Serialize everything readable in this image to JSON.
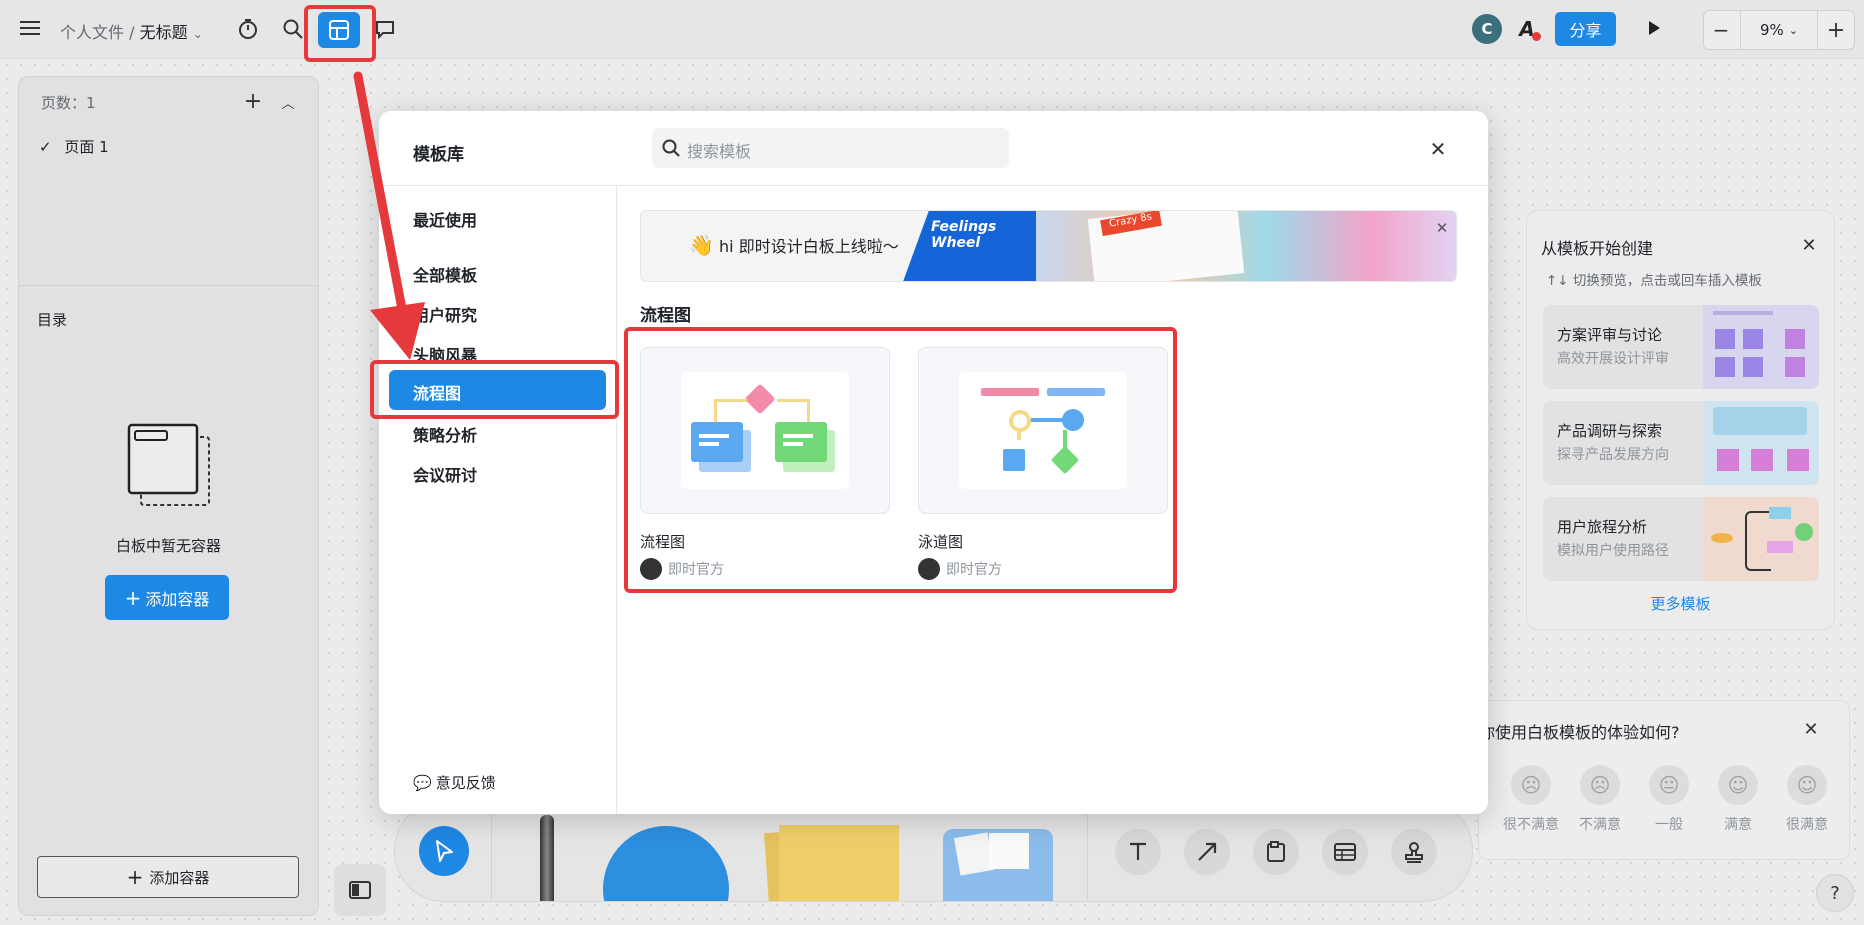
{
  "topbar": {
    "breadcrumb_root": "个人文件",
    "breadcrumb_sep": "/",
    "breadcrumb_title": "无标题",
    "avatar_letter": "C",
    "share_label": "分享",
    "zoom_value": "9%",
    "zoom_minus": "−",
    "zoom_plus": "+"
  },
  "sidebar": {
    "pages_label": "页数：1",
    "page_item": "页面 1",
    "toc_label": "目录",
    "empty_text": "白板中暂无容器",
    "add_container_primary": "添加容器",
    "add_container_bottom": "添加容器"
  },
  "modal": {
    "title": "模板库",
    "search_placeholder": "搜索模板",
    "nav": [
      "最近使用",
      "全部模板",
      "用户研究",
      "头脑风暴",
      "流程图",
      "策略分析",
      "会议研讨"
    ],
    "active_nav": "流程图",
    "feedback": "意见反馈",
    "banner_text_1": "hi",
    "banner_text_2": "即时设计白板上线啦～",
    "banner_fw": "Feelings Wheel",
    "banner_crazy": "Crazy 8s",
    "section_title": "流程图",
    "cards": [
      {
        "name": "流程图",
        "author": "即时官方"
      },
      {
        "name": "泳道图",
        "author": "即时官方"
      }
    ]
  },
  "right_panel": {
    "title": "从模板开始创建",
    "hint": "↑↓ 切换预览，点击或回车插入模板",
    "items": [
      {
        "title": "方案评审与讨论",
        "desc": "高效开展设计评审"
      },
      {
        "title": "产品调研与探索",
        "desc": "探寻产品发展方向"
      },
      {
        "title": "用户旅程分析",
        "desc": "模拟用户使用路径"
      }
    ],
    "more": "更多模板"
  },
  "survey": {
    "question": "你使用白板模板的体验如何?",
    "options": [
      "很不满意",
      "不满意",
      "一般",
      "满意",
      "很满意"
    ]
  },
  "help": "?",
  "colors": {
    "accent": "#1e88e5",
    "red_highlight": "#e5393b"
  }
}
